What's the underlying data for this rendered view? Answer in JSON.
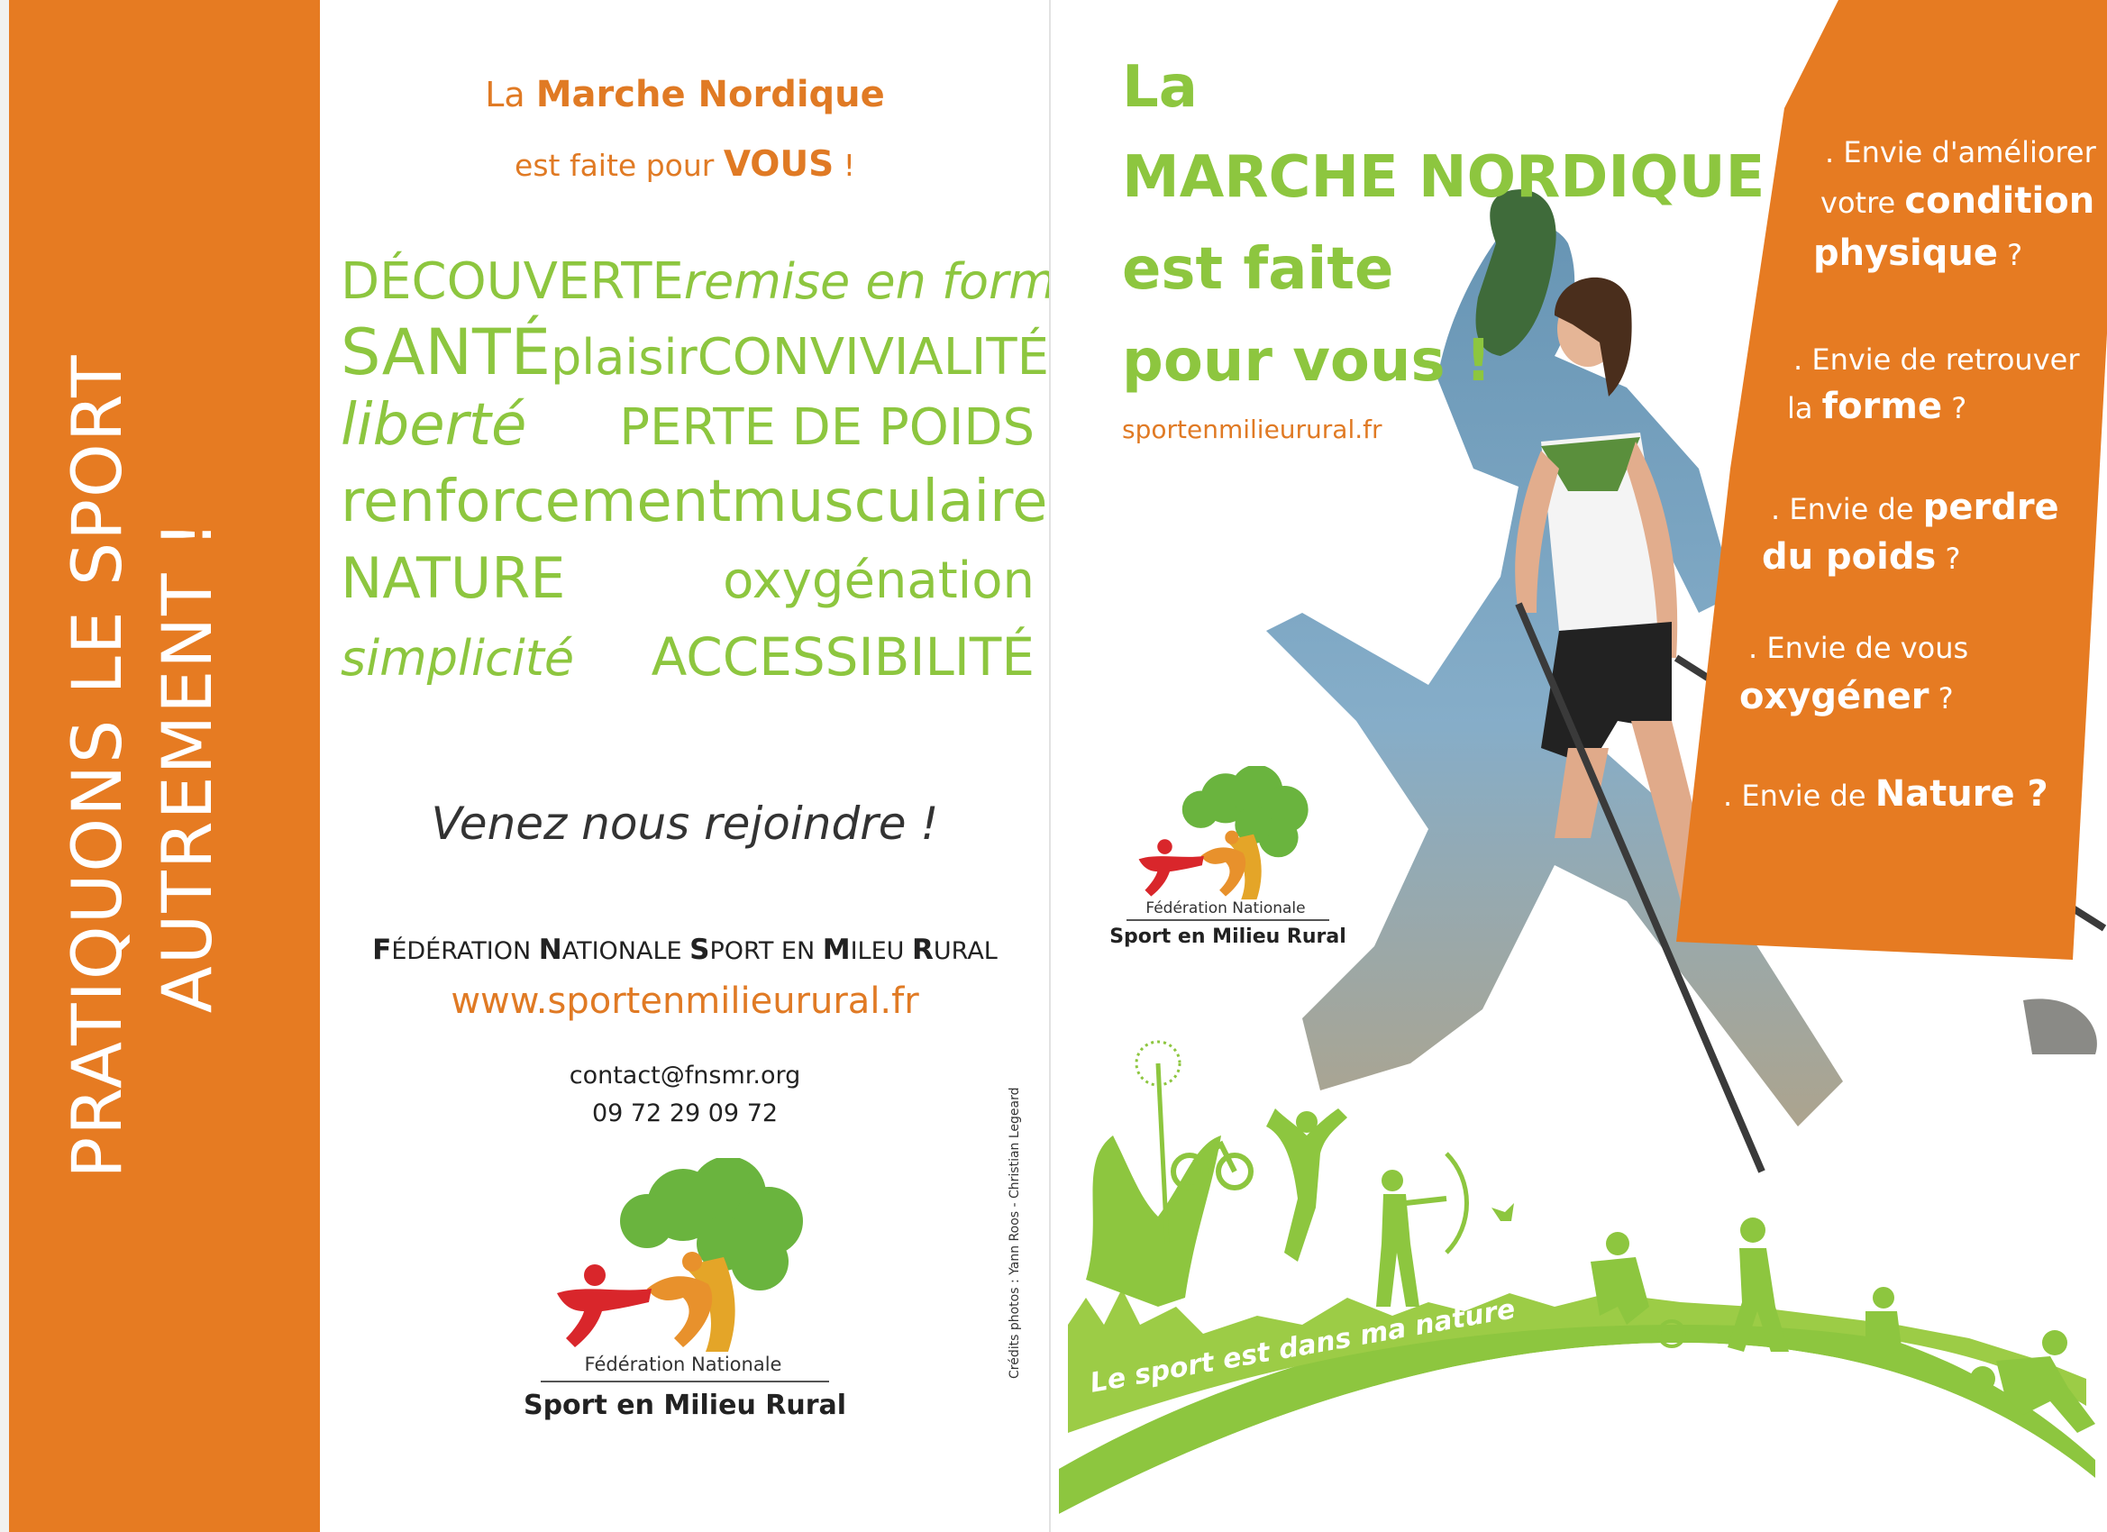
{
  "band": {
    "line1": "PRATIQUONS LE SPORT",
    "line2": "AUTREMENT !"
  },
  "left": {
    "headline": {
      "prefix": "La ",
      "brand": "Marche Nordique",
      "line2_prefix": "est faite pour ",
      "line2_emph": "VOUS",
      "line2_suffix": " !"
    },
    "word_cloud": [
      [
        "DÉCOUVERTE",
        "remise en forme"
      ],
      [
        "SANTÉ",
        "plaisir",
        "CONVIVIALITÉ"
      ],
      [
        "liberté",
        "PERTE DE POIDS"
      ],
      [
        "renforcement",
        "musculaire"
      ],
      [
        "NATURE",
        "oxygénation"
      ],
      [
        "simplicité",
        "ACCESSIBILITÉ"
      ]
    ],
    "join": "Venez nous rejoindre !",
    "federation": {
      "F": "F",
      "w1": "ÉDÉRATION ",
      "N": "N",
      "w2": "ATIONALE ",
      "S": "S",
      "w3": "PORT EN ",
      "M": "M",
      "w4": "ILEU ",
      "R": "R",
      "w5": "URAL"
    },
    "website": "www.sportenmilieurural.fr",
    "email": "contact@fnsmr.org",
    "phone": "09 72 29 09 72",
    "logo": {
      "caption1": "Fédération Nationale",
      "caption2": "Sport en Milieu Rural"
    },
    "credits": "Crédits photos : Yann Roos - Christian Legeard"
  },
  "right": {
    "title": [
      "La",
      "MARCHE NORDIQUE",
      "est faite",
      "pour vous !"
    ],
    "site": "sportenmilieurural.fr",
    "logo": {
      "caption1": "Fédération Nationale",
      "caption2": "Sport en Milieu Rural"
    },
    "questions": [
      {
        "l1a": ". Envie d'améliorer",
        "l2a": "votre ",
        "l2b": "condition",
        "l3b": "physique",
        "l3c": " ?"
      },
      {
        "l1a": ". Envie de retrouver",
        "l2a": "la ",
        "l2b": "forme",
        "l2c": " ?"
      },
      {
        "l1a": ". Envie de ",
        "l1b": "perdre",
        "l2b": "du poids",
        "l2c": " ?"
      },
      {
        "l1a": ". Envie de vous",
        "l2b": "oxygéner",
        "l2c": " ?"
      },
      {
        "l1a": ". Envie de ",
        "l1b": "Nature ?"
      }
    ],
    "slogan": "Le sport est dans ma nature"
  },
  "colors": {
    "orange": "#e67b22",
    "green": "#8dc63f",
    "red": "#d9262b",
    "white": "#ffffff"
  }
}
